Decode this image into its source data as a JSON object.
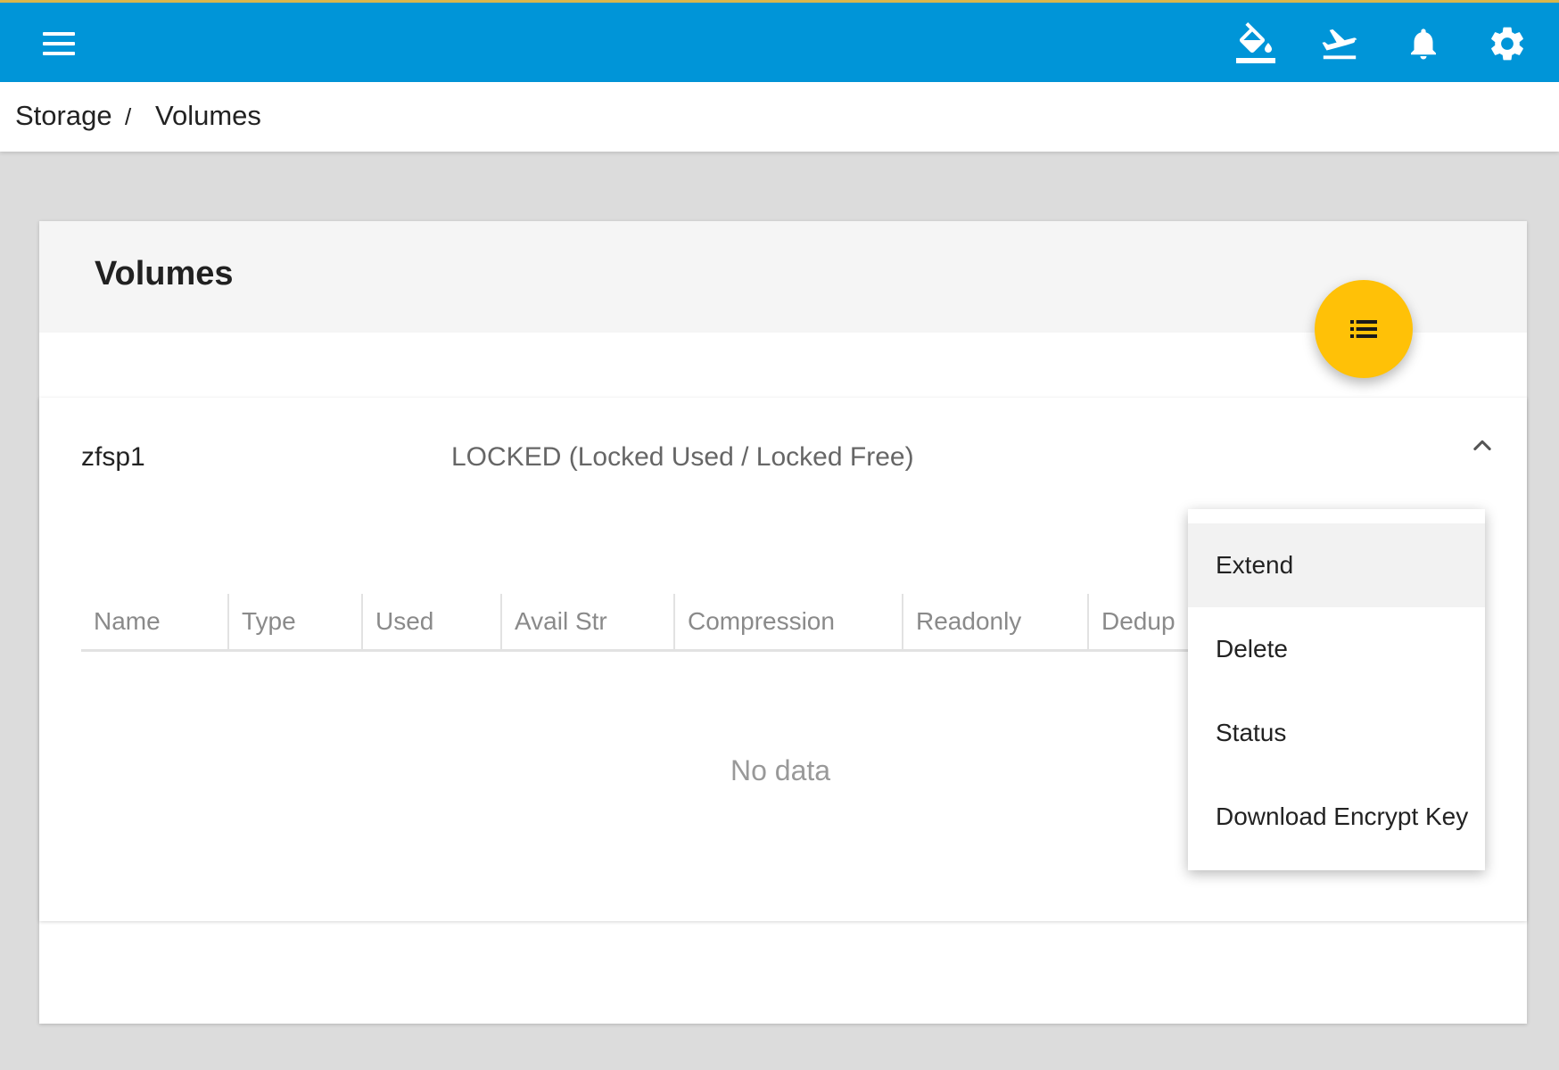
{
  "topbar": {
    "menu_icon": "hamburger-icon",
    "icons": [
      "paint-bucket-icon",
      "airplane-takeoff-icon",
      "bell-icon",
      "gear-icon"
    ],
    "background": "#0095d8"
  },
  "breadcrumb": {
    "items": [
      "Storage",
      "Volumes"
    ],
    "separator": "/"
  },
  "card": {
    "title": "Volumes",
    "fab_icon": "list-icon",
    "fab_color": "#ffc107"
  },
  "pool": {
    "name": "zfsp1",
    "status": "LOCKED (Locked Used / Locked Free)",
    "collapse_icon": "chevron-up-icon"
  },
  "table": {
    "columns": [
      "Name",
      "Type",
      "Used",
      "Avail Str",
      "Compression",
      "Readonly",
      "Dedup"
    ],
    "empty_text": "No data"
  },
  "menu": {
    "items": [
      "Extend",
      "Delete",
      "Status",
      "Download Encrypt Key"
    ]
  }
}
